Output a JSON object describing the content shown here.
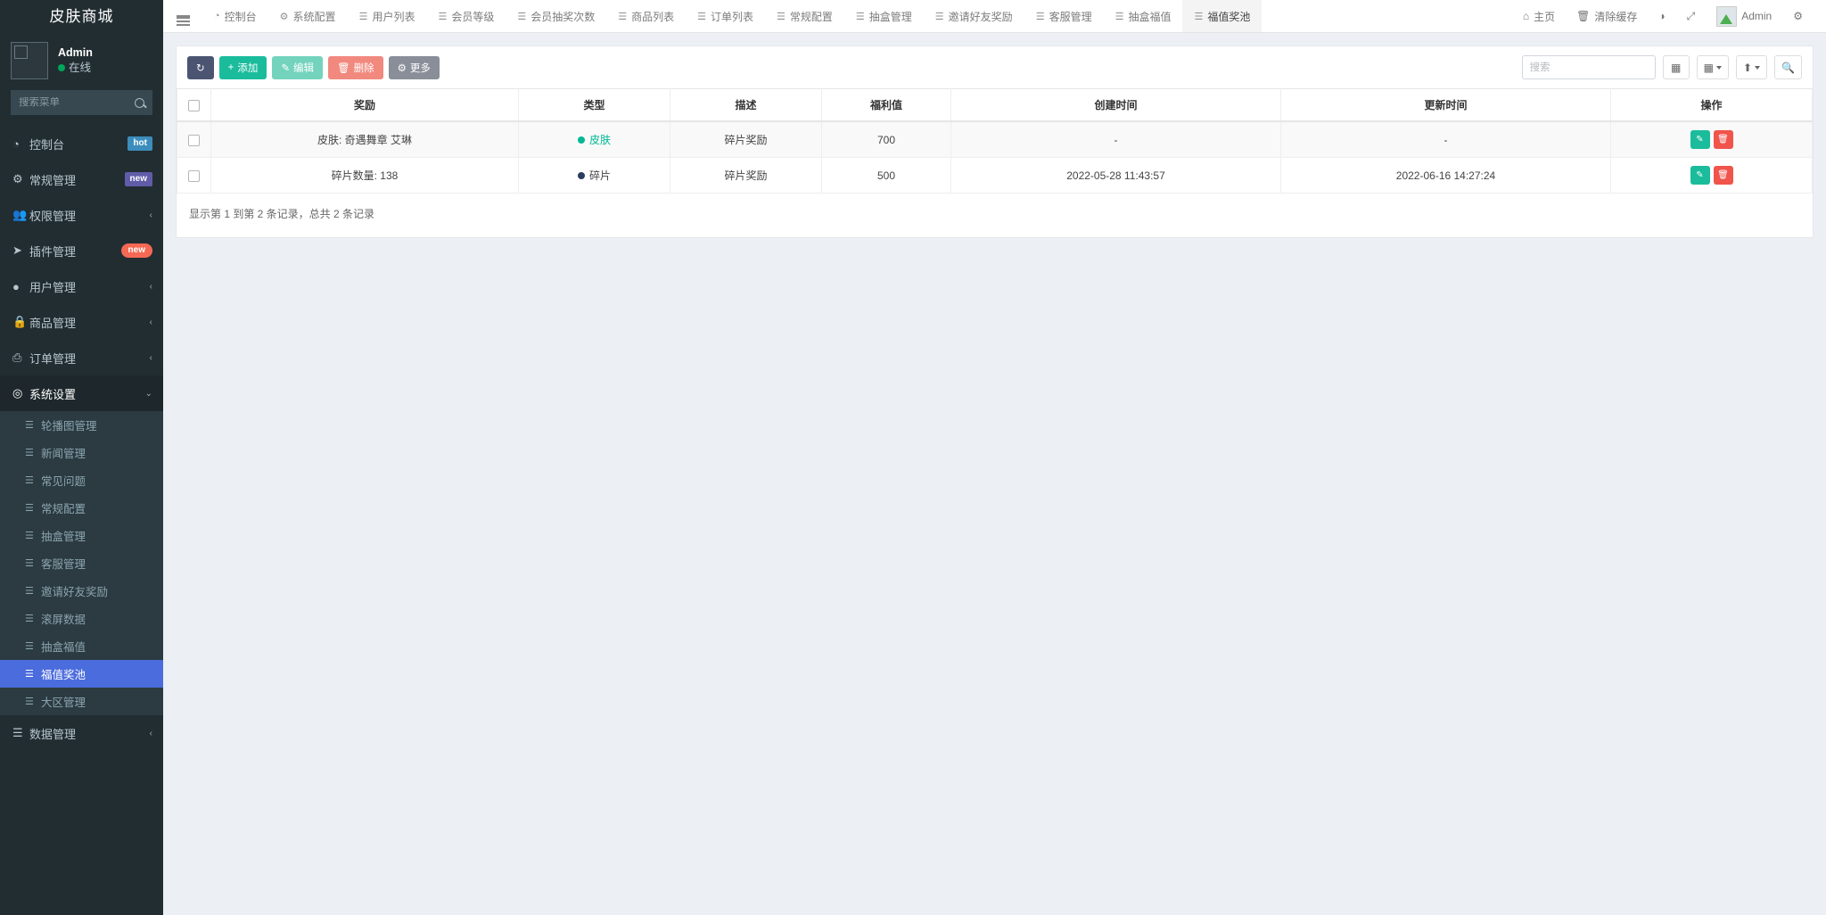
{
  "brand": {
    "title": "皮肤商城"
  },
  "user": {
    "name": "Admin",
    "status": "在线",
    "avatar_icon": "user-avatar-icon"
  },
  "menu_search": {
    "placeholder": "搜索菜单",
    "value": "",
    "icon": "search-icon"
  },
  "sidebar": {
    "items": [
      {
        "label": "控制台",
        "icon": "dashboard-icon",
        "badge": "hot",
        "badge_type": "hot"
      },
      {
        "label": "常规管理",
        "icon": "cogs-icon",
        "badge": "new",
        "badge_type": "new-purple"
      },
      {
        "label": "权限管理",
        "icon": "users-icon",
        "chevron": "‹"
      },
      {
        "label": "插件管理",
        "icon": "rocket-icon",
        "badge": "new",
        "badge_type": "new-red"
      },
      {
        "label": "用户管理",
        "icon": "user-circle-icon",
        "chevron": "‹"
      },
      {
        "label": "商品管理",
        "icon": "lock-icon",
        "chevron": "‹"
      },
      {
        "label": "订单管理",
        "icon": "print-icon",
        "chevron": "‹"
      },
      {
        "label": "系统设置",
        "icon": "gear-circle-icon",
        "chevron": "⌄",
        "open": true
      }
    ],
    "sub_items": [
      {
        "label": "轮播图管理",
        "icon": "list-icon"
      },
      {
        "label": "新闻管理",
        "icon": "list-icon"
      },
      {
        "label": "常见问题",
        "icon": "list-icon"
      },
      {
        "label": "常规配置",
        "icon": "list-icon"
      },
      {
        "label": "抽盒管理",
        "icon": "list-icon"
      },
      {
        "label": "客服管理",
        "icon": "list-icon"
      },
      {
        "label": "邀请好友奖励",
        "icon": "list-icon"
      },
      {
        "label": "滚屏数据",
        "icon": "list-icon"
      },
      {
        "label": "抽盒福值",
        "icon": "list-icon"
      },
      {
        "label": "福值奖池",
        "icon": "list-icon",
        "active": true
      },
      {
        "label": "大区管理",
        "icon": "list-icon"
      }
    ],
    "tail_items": [
      {
        "label": "数据管理",
        "icon": "database-icon",
        "chevron": "‹"
      }
    ]
  },
  "header": {
    "hamburger_icon": "hamburger-icon",
    "tabs": [
      {
        "label": "控制台",
        "icon": "dashboard-icon"
      },
      {
        "label": "系统配置",
        "icon": "gear-icon"
      },
      {
        "label": "用户列表",
        "icon": "list-icon"
      },
      {
        "label": "会员等级",
        "icon": "list-icon"
      },
      {
        "label": "会员抽奖次数",
        "icon": "list-icon"
      },
      {
        "label": "商品列表",
        "icon": "list-icon"
      },
      {
        "label": "订单列表",
        "icon": "list-icon"
      },
      {
        "label": "常规配置",
        "icon": "list-icon"
      },
      {
        "label": "抽盒管理",
        "icon": "list-icon"
      },
      {
        "label": "邀请好友奖励",
        "icon": "list-icon"
      },
      {
        "label": "客服管理",
        "icon": "list-icon"
      },
      {
        "label": "抽盒福值",
        "icon": "list-icon"
      },
      {
        "label": "福值奖池",
        "icon": "list-icon",
        "active": true
      }
    ],
    "right": [
      {
        "label": "主页",
        "icon": "home-icon"
      },
      {
        "label": "清除缓存",
        "icon": "trash-icon"
      },
      {
        "label": "",
        "icon": "theme-icon"
      },
      {
        "label": "",
        "icon": "fullscreen-icon"
      }
    ],
    "account": {
      "label": "Admin",
      "avatar_icon": "user-avatar-icon"
    },
    "settings_icon": "cogs-icon"
  },
  "toolbar": {
    "refresh_label": "",
    "refresh_icon": "refresh-icon",
    "add_label": "添加",
    "add_icon": "plus-icon",
    "edit_label": "编辑",
    "edit_icon": "pencil-icon",
    "delete_label": "删除",
    "delete_icon": "trash-icon",
    "more_label": "更多",
    "more_icon": "gear-icon",
    "search_placeholder": "搜索",
    "search_value": "",
    "columns_icon": "columns-icon",
    "grid_icon": "grid-icon",
    "export_icon": "export-icon",
    "search_icon": "search-icon"
  },
  "table": {
    "columns": [
      "",
      "奖励",
      "类型",
      "描述",
      "福利值",
      "创建时间",
      "更新时间",
      "操作"
    ],
    "rows": [
      {
        "reward": "皮肤: 奇遇舞章 艾琳",
        "type": "皮肤",
        "type_color": "#00b894",
        "type_text_color": "#00b894",
        "desc": "碎片奖励",
        "welfare": "700",
        "created": "-",
        "updated": "-"
      },
      {
        "reward": "碎片数量: 138",
        "type": "碎片",
        "type_color": "#2c3e5e",
        "type_text_color": "#444444",
        "desc": "碎片奖励",
        "welfare": "500",
        "created": "2022-05-28 11:43:57",
        "updated": "2022-06-16 14:27:24"
      }
    ],
    "row_actions": {
      "edit_icon": "pencil-icon",
      "delete_icon": "trash-icon"
    }
  },
  "footer": {
    "count_text": "显示第 1 到第 2 条记录，总共 2 条记录"
  },
  "colors": {
    "sidebar_bg": "#222d32",
    "sidebar_sub_bg": "#2c3b41",
    "active_blue": "#4b6cdd",
    "accent_teal": "#1abc9c",
    "danger_red": "#f1544b",
    "content_bg": "#ecf0f5"
  }
}
